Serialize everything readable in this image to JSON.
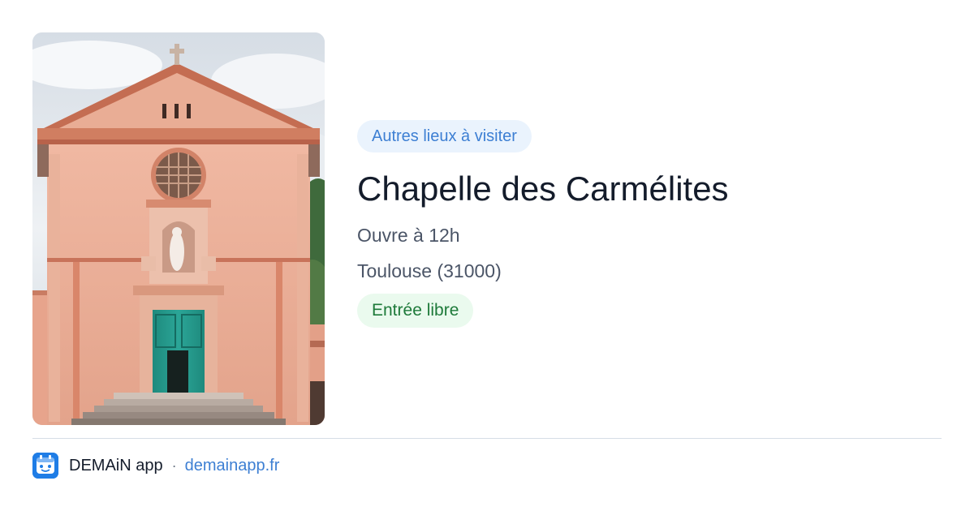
{
  "place": {
    "category": "Autres lieux à visiter",
    "name": "Chapelle des Carmélites",
    "hours": "Ouvre à 12h",
    "location": "Toulouse (31000)",
    "price": "Entrée libre"
  },
  "footer": {
    "app_name": "DEMAiN app",
    "separator": "·",
    "domain": "demainapp.fr"
  },
  "colors": {
    "category_pill_bg": "#eaf3fd",
    "category_pill_text": "#3d7fd3",
    "price_pill_bg": "#eafaee",
    "price_pill_text": "#1e7a3a",
    "title_text": "#141c2b",
    "secondary_text": "#4b5567",
    "link": "#3d7fd3",
    "app_logo": "#1f7de6"
  },
  "icons": {
    "app_logo": "demain-app-logo-icon",
    "photo": "chapel-facade-photo"
  }
}
